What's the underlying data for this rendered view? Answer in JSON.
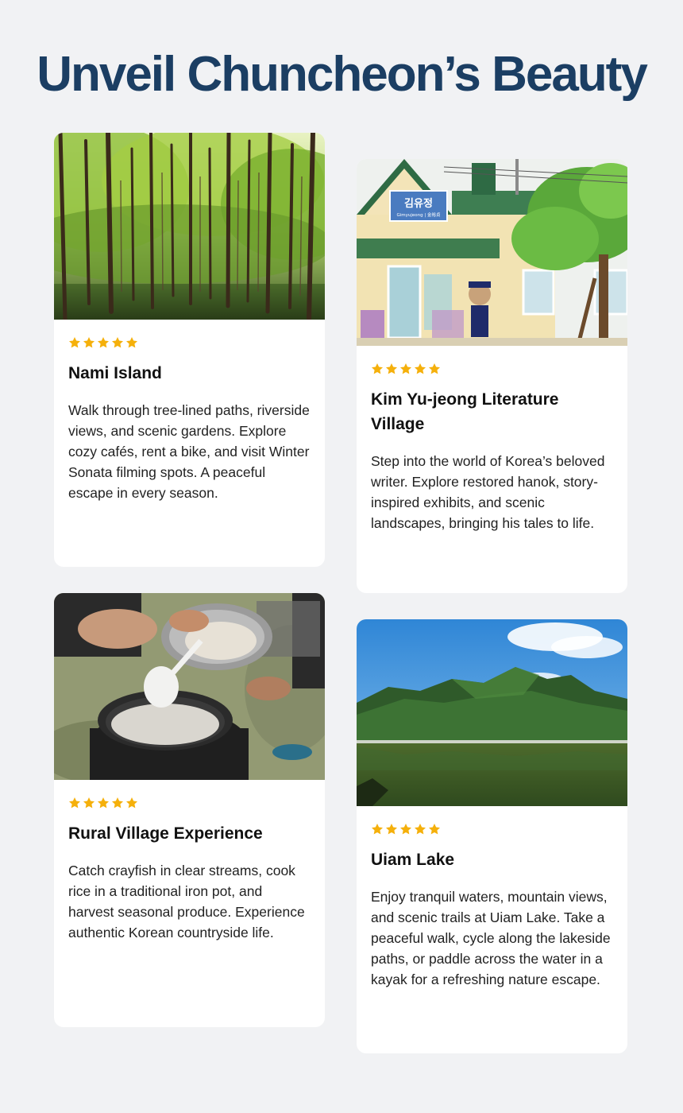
{
  "page": {
    "title": "Unveil Chuncheon’s Beauty"
  },
  "colors": {
    "background": "#f1f2f4",
    "title": "#1b3e63",
    "star": "#f5b00b",
    "card": "#ffffff"
  },
  "cards": [
    {
      "title": "Nami Island",
      "rating_stars": 5,
      "description": "Walk through tree-lined paths, riverside views, and scenic gardens. Explore cozy cafés, rent a bike, and visit Winter Sonata filming spots. A peaceful escape in every season.",
      "image": "forest-of-tall-trees"
    },
    {
      "title": "Kim Yu-jeong Literature Village",
      "rating_stars": 5,
      "description": "Step into the world of Korea’s beloved writer. Explore restored hanok, story-inspired exhibits, and scenic landscapes, bringing his tales to life.",
      "image": "station-building",
      "sign": {
        "korean": "김유정",
        "roman": "Gimyujeong | 金裕貞"
      }
    },
    {
      "title": "Rural Village Experience",
      "rating_stars": 5,
      "description": "Catch crayfish in clear streams, cook rice in a traditional iron pot, and harvest seasonal produce. Experience authentic Korean countryside life.",
      "image": "cooking-rice-in-iron-pot"
    },
    {
      "title": "Uiam Lake",
      "rating_stars": 5,
      "description": "Enjoy tranquil waters, mountain views, and scenic trails at Uiam Lake. Take a peaceful walk, cycle along the lakeside paths, or paddle across the water in a kayak for a refreshing nature escape.",
      "image": "lake-and-mountains"
    }
  ]
}
